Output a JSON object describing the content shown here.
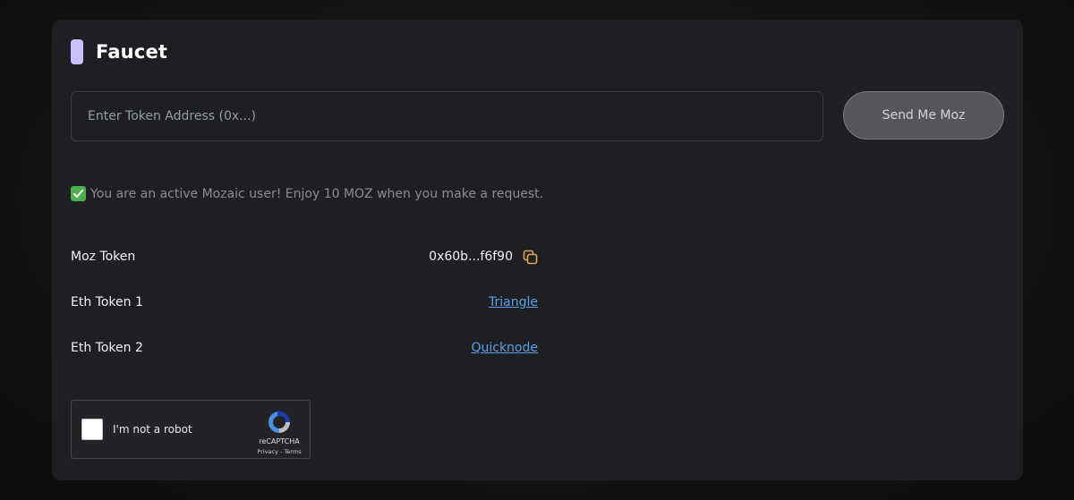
{
  "faucet": {
    "title": "Faucet",
    "accent_color": "#c9c0ff"
  },
  "address_input": {
    "placeholder": "Enter Token Address (0x...)",
    "value": ""
  },
  "send_button": {
    "label": "Send Me Moz"
  },
  "notice": {
    "icon": "check-mark-icon",
    "text": "You are an active Mozaic user! Enjoy 10 MOZ when you make a request."
  },
  "tokens": [
    {
      "label": "Moz Token",
      "value": "0x60b...f6f90",
      "icon": "copy-icon"
    },
    {
      "label": "Eth Token 1",
      "link": "Triangle"
    },
    {
      "label": "Eth Token 2",
      "link": "Quicknode"
    }
  ],
  "captcha": {
    "label": "I'm not a robot",
    "brand": "reCAPTCHA",
    "privacy": "Privacy",
    "separator": " - ",
    "terms": "Terms"
  }
}
